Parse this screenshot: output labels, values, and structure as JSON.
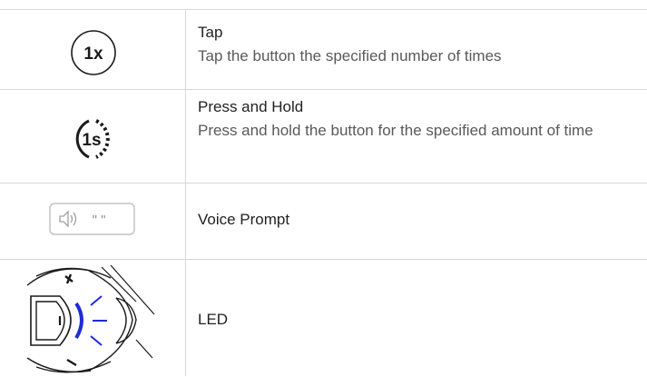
{
  "legend": {
    "rows": [
      {
        "icon_text": "1x",
        "icon": "tap-icon",
        "term": "Tap",
        "description": "Tap the button the specified number of times"
      },
      {
        "icon_text": "1s",
        "icon": "press-and-hold-icon",
        "term": "Press and Hold",
        "description": "Press and hold the button for the specified amount of time"
      },
      {
        "icon_text": "\" \"",
        "icon": "voice-prompt-icon",
        "term": "Voice Prompt",
        "description": ""
      },
      {
        "icon_text": "",
        "icon": "led-icon",
        "term": "LED",
        "description": ""
      }
    ]
  },
  "colors": {
    "divider": "#d6d6d6",
    "led_blue": "#1f2bd6",
    "icon_dark": "#1a1a1a",
    "icon_light_border": "#c4c4c4",
    "description_text": "#595959"
  }
}
